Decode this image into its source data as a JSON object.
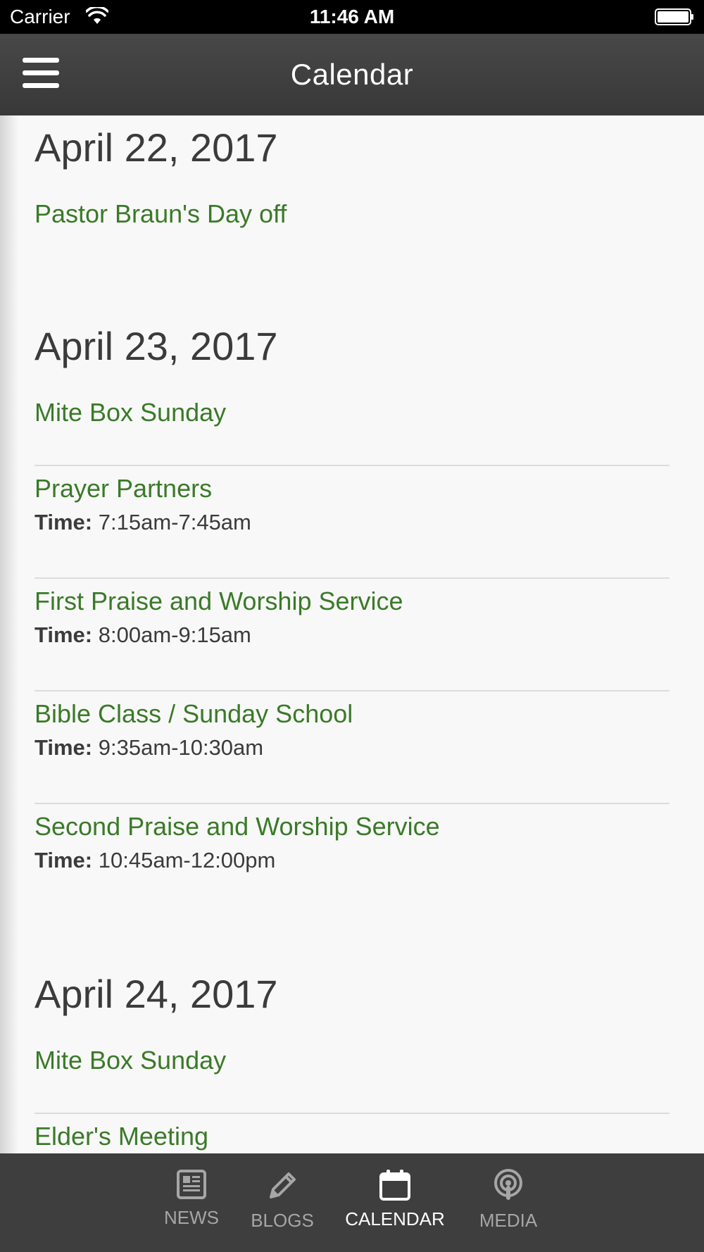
{
  "status_bar": {
    "carrier": "Carrier",
    "time": "11:46 AM"
  },
  "nav": {
    "title": "Calendar",
    "menu_icon": "hamburger-menu-icon"
  },
  "days": [
    {
      "date": "April 22, 2017",
      "events": [
        {
          "title": "Pastor Braun's Day off",
          "time_label": "",
          "time": ""
        }
      ]
    },
    {
      "date": "April 23, 2017",
      "events": [
        {
          "title": "Mite Box Sunday",
          "time_label": "",
          "time": ""
        },
        {
          "title": "Prayer Partners",
          "time_label": "Time:",
          "time": "7:15am-7:45am"
        },
        {
          "title": "First Praise and Worship Service",
          "time_label": "Time:",
          "time": "8:00am-9:15am"
        },
        {
          "title": "Bible Class / Sunday School",
          "time_label": "Time:",
          "time": "9:35am-10:30am"
        },
        {
          "title": "Second Praise and Worship Service",
          "time_label": "Time:",
          "time": "10:45am-12:00pm"
        }
      ]
    },
    {
      "date": "April 24, 2017",
      "events": [
        {
          "title": "Mite Box Sunday",
          "time_label": "",
          "time": ""
        },
        {
          "title": "Elder's Meeting",
          "time_label": "",
          "time": ""
        }
      ]
    }
  ],
  "tabs": [
    {
      "label": "NEWS",
      "icon": "newspaper-icon",
      "active": false
    },
    {
      "label": "BLOGS",
      "icon": "pencil-icon",
      "active": false
    },
    {
      "label": "CALENDAR",
      "icon": "calendar-icon",
      "active": true
    },
    {
      "label": "MEDIA",
      "icon": "podcast-icon",
      "active": false
    }
  ],
  "colors": {
    "event_title": "#3a7a28",
    "heading_text": "#3b3b3b",
    "nav_bg": "#404040",
    "tab_bar_bg": "#3e3e3e",
    "tab_inactive": "#a6a6a6",
    "tab_active": "#ffffff"
  }
}
